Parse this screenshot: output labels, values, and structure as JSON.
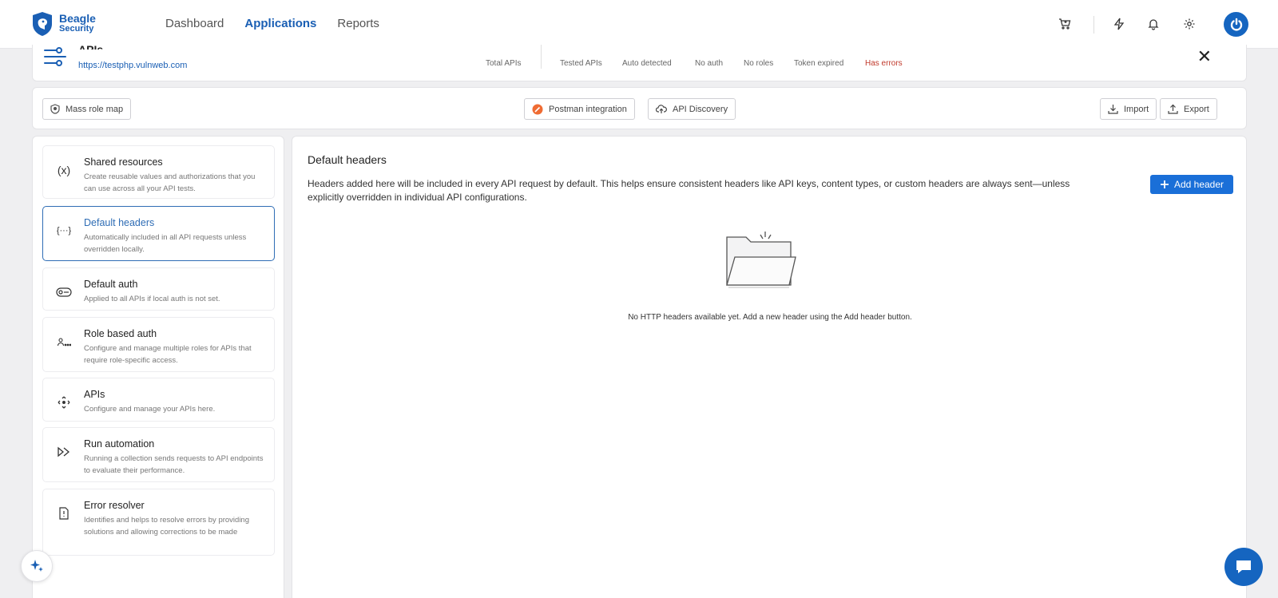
{
  "brand": {
    "line1": "Beagle",
    "line2": "Security"
  },
  "nav": {
    "dashboard": "Dashboard",
    "applications": "Applications",
    "reports": "Reports"
  },
  "nav_icons": [
    "cart-icon",
    "bolt-icon",
    "bell-icon",
    "gear-icon"
  ],
  "apis_header": {
    "title": "APIs",
    "url": "https://testphp.vulnweb.com",
    "stats": {
      "total": "Total APIs",
      "tested": "Tested APIs",
      "auto": "Auto detected",
      "noauth": "No auth",
      "noroles": "No roles",
      "token": "Token expired",
      "errors": "Has errors"
    }
  },
  "toolbar": {
    "mass_role": "Mass role map",
    "postman": "Postman integration",
    "discovery": "API Discovery",
    "import": "Import",
    "export": "Export"
  },
  "sidebar": {
    "items": [
      {
        "title": "Shared resources",
        "desc": "Create reusable values and authorizations that you can use across all your API tests."
      },
      {
        "title": "Default headers",
        "desc": "Automatically included in all API requests unless overridden locally."
      },
      {
        "title": "Default auth",
        "desc": "Applied to all APIs if local auth is not set."
      },
      {
        "title": "Role based auth",
        "desc": "Configure and manage multiple roles for APIs that require role-specific access."
      },
      {
        "title": "APIs",
        "desc": "Configure and manage your APIs here."
      },
      {
        "title": "Run automation",
        "desc": "Running a collection sends requests to API endpoints to evaluate their performance."
      },
      {
        "title": "Error resolver",
        "desc": "Identifies and helps to resolve errors by providing solutions and allowing corrections to be made"
      }
    ]
  },
  "main": {
    "title": "Default headers",
    "desc": "Headers added here will be included in every API request by default. This helps ensure consistent headers like API keys, content types, or custom headers are always sent—unless explicitly overridden in individual API configurations.",
    "add_button": "Add header",
    "empty_text": "No HTTP headers available yet. Add a new header using the Add header button."
  },
  "colors": {
    "accent": "#1a6fd8",
    "brand": "#1a5fb4",
    "error": "#c0392b"
  }
}
